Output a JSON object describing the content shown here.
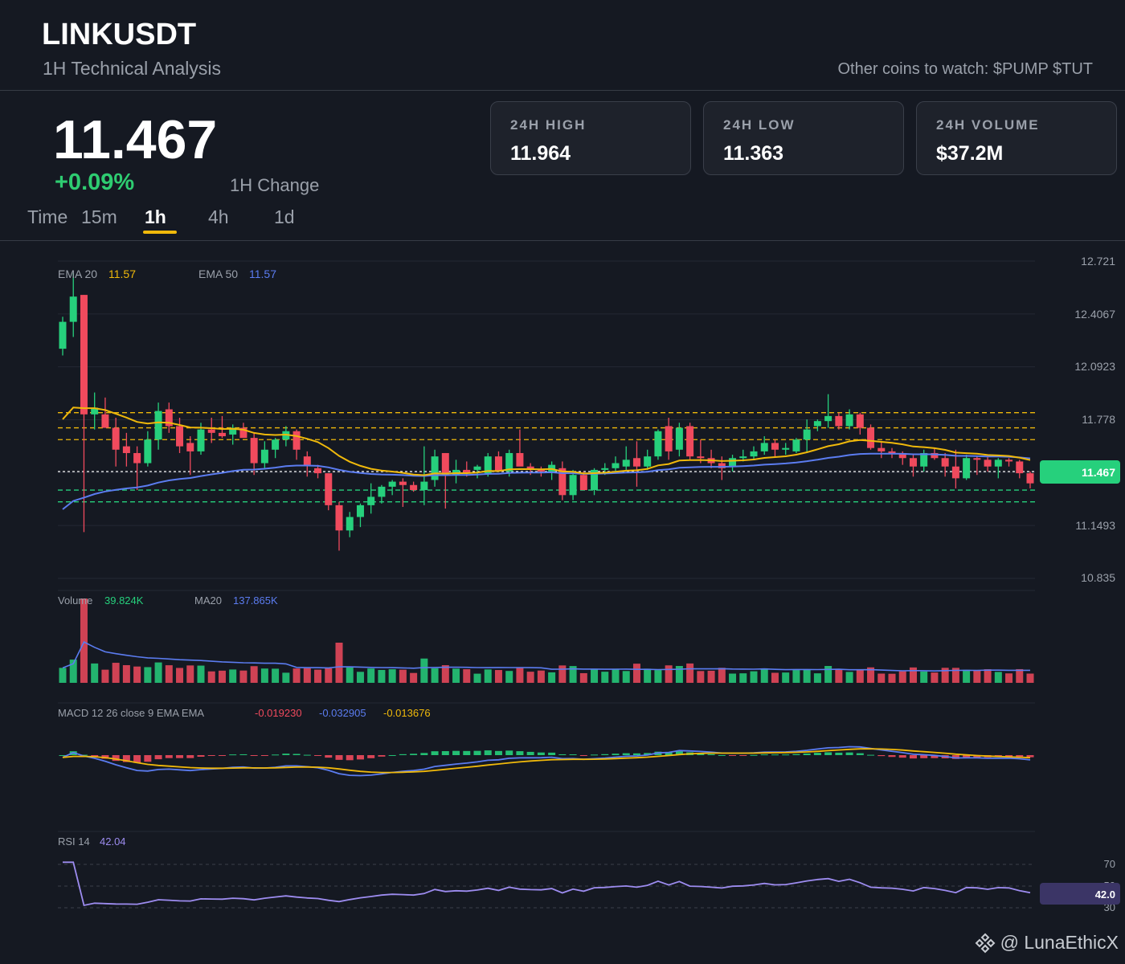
{
  "header": {
    "symbol": "LINKUSDT",
    "subtitle": "1H Technical Analysis",
    "watch": "Other coins to watch: $PUMP $TUT"
  },
  "price": {
    "last": "11.467",
    "change": "+0.09%",
    "change_label": "1H Change"
  },
  "timeframes": {
    "label": "Time",
    "items": [
      "15m",
      "1h",
      "4h",
      "1d"
    ],
    "active": "1h"
  },
  "stats": [
    {
      "label": "24H HIGH",
      "value": "11.964"
    },
    {
      "label": "24H LOW",
      "value": "11.363"
    },
    {
      "label": "24H VOLUME",
      "value": "$37.2M"
    }
  ],
  "brand": "@ LunaEthicX",
  "colors": {
    "up": "#26d07c",
    "down": "#f04a5d",
    "ema20": "#f0b90b",
    "ema50": "#5b7cf0",
    "rsi": "#9d8cf0",
    "accent": "#f0b90b"
  },
  "chart_data": [
    {
      "type": "candlestick",
      "title": "",
      "legend": [
        {
          "label": "EMA 20",
          "value": "11.57"
        },
        {
          "label": "EMA 50",
          "value": "11.57"
        }
      ],
      "yticks": [
        "12.721",
        "12.4067",
        "12.0923",
        "11.778",
        "11.4637",
        "11.1493",
        "10.835"
      ],
      "ylim": [
        10.835,
        12.721
      ],
      "last_price_label": "11.467",
      "levels_resistance": [
        11.82,
        11.73,
        11.66
      ],
      "levels_support": [
        11.47,
        11.36,
        11.29
      ],
      "candles": [
        {
          "o": 12.2,
          "h": 12.39,
          "l": 12.16,
          "c": 12.36
        },
        {
          "o": 12.36,
          "h": 12.65,
          "l": 12.27,
          "c": 12.51
        },
        {
          "o": 12.52,
          "h": 12.52,
          "l": 11.11,
          "c": 11.81
        },
        {
          "o": 11.81,
          "h": 11.94,
          "l": 11.72,
          "c": 11.85
        },
        {
          "o": 11.81,
          "h": 11.91,
          "l": 11.74,
          "c": 11.73
        },
        {
          "o": 11.73,
          "h": 11.79,
          "l": 11.5,
          "c": 11.6
        },
        {
          "o": 11.62,
          "h": 11.7,
          "l": 11.5,
          "c": 11.58
        },
        {
          "o": 11.58,
          "h": 11.62,
          "l": 11.36,
          "c": 11.52
        },
        {
          "o": 11.52,
          "h": 11.71,
          "l": 11.5,
          "c": 11.66
        },
        {
          "o": 11.66,
          "h": 11.88,
          "l": 11.6,
          "c": 11.83
        },
        {
          "o": 11.84,
          "h": 11.88,
          "l": 11.7,
          "c": 11.74
        },
        {
          "o": 11.74,
          "h": 11.79,
          "l": 11.58,
          "c": 11.62
        },
        {
          "o": 11.64,
          "h": 11.68,
          "l": 11.45,
          "c": 11.59
        },
        {
          "o": 11.59,
          "h": 11.76,
          "l": 11.57,
          "c": 11.72
        },
        {
          "o": 11.72,
          "h": 11.79,
          "l": 11.64,
          "c": 11.7
        },
        {
          "o": 11.7,
          "h": 11.8,
          "l": 11.67,
          "c": 11.68
        },
        {
          "o": 11.69,
          "h": 11.75,
          "l": 11.63,
          "c": 11.73
        },
        {
          "o": 11.73,
          "h": 11.76,
          "l": 11.7,
          "c": 11.67
        },
        {
          "o": 11.67,
          "h": 11.7,
          "l": 11.45,
          "c": 11.52
        },
        {
          "o": 11.52,
          "h": 11.65,
          "l": 11.49,
          "c": 11.6
        },
        {
          "o": 11.6,
          "h": 11.67,
          "l": 11.55,
          "c": 11.66
        },
        {
          "o": 11.66,
          "h": 11.74,
          "l": 11.62,
          "c": 11.71
        },
        {
          "o": 11.71,
          "h": 11.72,
          "l": 11.54,
          "c": 11.6
        },
        {
          "o": 11.56,
          "h": 11.59,
          "l": 11.44,
          "c": 11.51
        },
        {
          "o": 11.49,
          "h": 11.51,
          "l": 11.43,
          "c": 11.46
        },
        {
          "o": 11.46,
          "h": 11.46,
          "l": 11.24,
          "c": 11.27
        },
        {
          "o": 11.27,
          "h": 11.29,
          "l": 11.0,
          "c": 11.12
        },
        {
          "o": 11.12,
          "h": 11.23,
          "l": 11.08,
          "c": 11.2
        },
        {
          "o": 11.2,
          "h": 11.28,
          "l": 11.14,
          "c": 11.27
        },
        {
          "o": 11.27,
          "h": 11.4,
          "l": 11.22,
          "c": 11.32
        },
        {
          "o": 11.32,
          "h": 11.39,
          "l": 11.28,
          "c": 11.38
        },
        {
          "o": 11.38,
          "h": 11.42,
          "l": 11.33,
          "c": 11.41
        },
        {
          "o": 11.41,
          "h": 11.43,
          "l": 11.26,
          "c": 11.39
        },
        {
          "o": 11.39,
          "h": 11.41,
          "l": 11.35,
          "c": 11.36
        },
        {
          "o": 11.36,
          "h": 11.62,
          "l": 11.27,
          "c": 11.41
        },
        {
          "o": 11.42,
          "h": 11.6,
          "l": 11.38,
          "c": 11.56
        },
        {
          "o": 11.58,
          "h": 11.58,
          "l": 11.25,
          "c": 11.45
        },
        {
          "o": 11.45,
          "h": 11.54,
          "l": 11.4,
          "c": 11.48
        },
        {
          "o": 11.48,
          "h": 11.53,
          "l": 11.44,
          "c": 11.46
        },
        {
          "o": 11.48,
          "h": 11.51,
          "l": 11.43,
          "c": 11.5
        },
        {
          "o": 11.46,
          "h": 11.58,
          "l": 11.44,
          "c": 11.56
        },
        {
          "o": 11.56,
          "h": 11.59,
          "l": 11.5,
          "c": 11.47
        },
        {
          "o": 11.47,
          "h": 11.6,
          "l": 11.44,
          "c": 11.58
        },
        {
          "o": 11.58,
          "h": 11.72,
          "l": 11.52,
          "c": 11.5
        },
        {
          "o": 11.5,
          "h": 11.52,
          "l": 11.45,
          "c": 11.48
        },
        {
          "o": 11.48,
          "h": 11.5,
          "l": 11.44,
          "c": 11.47
        },
        {
          "o": 11.47,
          "h": 11.53,
          "l": 11.42,
          "c": 11.51
        },
        {
          "o": 11.49,
          "h": 11.53,
          "l": 11.3,
          "c": 11.33
        },
        {
          "o": 11.33,
          "h": 11.48,
          "l": 11.3,
          "c": 11.45
        },
        {
          "o": 11.45,
          "h": 11.47,
          "l": 11.36,
          "c": 11.36
        },
        {
          "o": 11.36,
          "h": 11.49,
          "l": 11.33,
          "c": 11.48
        },
        {
          "o": 11.48,
          "h": 11.52,
          "l": 11.45,
          "c": 11.49
        },
        {
          "o": 11.49,
          "h": 11.56,
          "l": 11.46,
          "c": 11.52
        },
        {
          "o": 11.5,
          "h": 11.62,
          "l": 11.48,
          "c": 11.54
        },
        {
          "o": 11.55,
          "h": 11.65,
          "l": 11.38,
          "c": 11.5
        },
        {
          "o": 11.5,
          "h": 11.6,
          "l": 11.48,
          "c": 11.56
        },
        {
          "o": 11.56,
          "h": 11.72,
          "l": 11.54,
          "c": 11.71
        },
        {
          "o": 11.74,
          "h": 11.79,
          "l": 11.54,
          "c": 11.59
        },
        {
          "o": 11.6,
          "h": 11.76,
          "l": 11.56,
          "c": 11.73
        },
        {
          "o": 11.74,
          "h": 11.76,
          "l": 11.54,
          "c": 11.56
        },
        {
          "o": 11.56,
          "h": 11.66,
          "l": 11.52,
          "c": 11.55
        },
        {
          "o": 11.55,
          "h": 11.6,
          "l": 11.49,
          "c": 11.52
        },
        {
          "o": 11.52,
          "h": 11.56,
          "l": 11.42,
          "c": 11.49
        },
        {
          "o": 11.5,
          "h": 11.57,
          "l": 11.47,
          "c": 11.55
        },
        {
          "o": 11.55,
          "h": 11.6,
          "l": 11.53,
          "c": 11.56
        },
        {
          "o": 11.56,
          "h": 11.62,
          "l": 11.54,
          "c": 11.59
        },
        {
          "o": 11.59,
          "h": 11.68,
          "l": 11.57,
          "c": 11.64
        },
        {
          "o": 11.64,
          "h": 11.66,
          "l": 11.56,
          "c": 11.6
        },
        {
          "o": 11.6,
          "h": 11.64,
          "l": 11.57,
          "c": 11.61
        },
        {
          "o": 11.59,
          "h": 11.67,
          "l": 11.58,
          "c": 11.66
        },
        {
          "o": 11.66,
          "h": 11.78,
          "l": 11.58,
          "c": 11.72
        },
        {
          "o": 11.74,
          "h": 11.78,
          "l": 11.71,
          "c": 11.77
        },
        {
          "o": 11.77,
          "h": 11.93,
          "l": 11.73,
          "c": 11.8
        },
        {
          "o": 11.8,
          "h": 11.82,
          "l": 11.72,
          "c": 11.74
        },
        {
          "o": 11.74,
          "h": 11.84,
          "l": 11.72,
          "c": 11.81
        },
        {
          "o": 11.81,
          "h": 11.82,
          "l": 11.69,
          "c": 11.73
        },
        {
          "o": 11.73,
          "h": 11.75,
          "l": 11.6,
          "c": 11.61
        },
        {
          "o": 11.61,
          "h": 11.65,
          "l": 11.55,
          "c": 11.59
        },
        {
          "o": 11.59,
          "h": 11.61,
          "l": 11.55,
          "c": 11.58
        },
        {
          "o": 11.58,
          "h": 11.59,
          "l": 11.51,
          "c": 11.55
        },
        {
          "o": 11.55,
          "h": 11.57,
          "l": 11.44,
          "c": 11.5
        },
        {
          "o": 11.5,
          "h": 11.6,
          "l": 11.47,
          "c": 11.58
        },
        {
          "o": 11.58,
          "h": 11.61,
          "l": 11.54,
          "c": 11.55
        },
        {
          "o": 11.55,
          "h": 11.58,
          "l": 11.44,
          "c": 11.5
        },
        {
          "o": 11.5,
          "h": 11.6,
          "l": 11.37,
          "c": 11.43
        },
        {
          "o": 11.43,
          "h": 11.57,
          "l": 11.42,
          "c": 11.55
        },
        {
          "o": 11.55,
          "h": 11.56,
          "l": 11.45,
          "c": 11.54
        },
        {
          "o": 11.54,
          "h": 11.56,
          "l": 11.47,
          "c": 11.5
        },
        {
          "o": 11.5,
          "h": 11.55,
          "l": 11.43,
          "c": 11.54
        },
        {
          "o": 11.54,
          "h": 11.55,
          "l": 11.5,
          "c": 11.53
        },
        {
          "o": 11.53,
          "h": 11.54,
          "l": 11.43,
          "c": 11.46
        },
        {
          "o": 11.46,
          "h": 11.47,
          "l": 11.37,
          "c": 11.4
        }
      ]
    },
    {
      "type": "bar",
      "title": "",
      "legend": [
        {
          "label": "Volume",
          "value": "39.824K"
        },
        {
          "label": "MA20",
          "value": "137.865K"
        }
      ]
    },
    {
      "type": "line",
      "title": "",
      "legend": [
        {
          "label": "MACD 12 26 close 9 EMA EMA",
          "value": ""
        },
        {
          "label": "",
          "value": "-0.019230"
        },
        {
          "label": "",
          "value": "-0.032905"
        },
        {
          "label": "",
          "value": "-0.013676"
        }
      ]
    },
    {
      "type": "line",
      "title": "",
      "legend": [
        {
          "label": "RSI 14",
          "value": "42.04"
        }
      ],
      "yticks": [
        "70",
        "50",
        "30"
      ],
      "last_value_label": "42.0"
    }
  ]
}
